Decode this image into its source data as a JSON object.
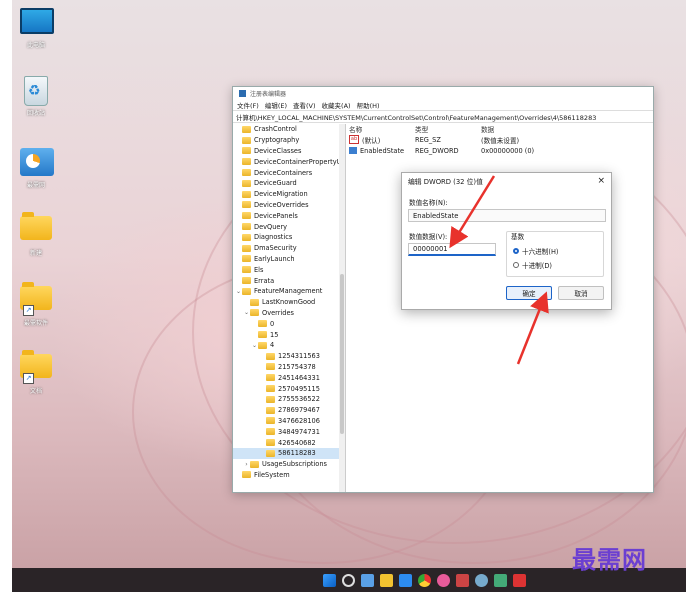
{
  "desktop": {
    "icons": [
      {
        "name": "此电脑"
      },
      {
        "name": "回收站"
      },
      {
        "name": "最需网"
      },
      {
        "name": "新建"
      },
      {
        "name": "最需软件"
      },
      {
        "name": "文档"
      }
    ]
  },
  "regedit": {
    "title": "注册表编辑器",
    "menu": [
      "文件(F)",
      "编辑(E)",
      "查看(V)",
      "收藏夹(A)",
      "帮助(H)"
    ],
    "address": "计算机\\HKEY_LOCAL_MACHINE\\SYSTEM\\CurrentControlSet\\Control\\FeatureManagement\\Overrides\\4\\586118283",
    "tree": [
      {
        "label": "CrashControl",
        "level": 0
      },
      {
        "label": "Cryptography",
        "level": 0
      },
      {
        "label": "DeviceClasses",
        "level": 0
      },
      {
        "label": "DeviceContainerPropertyUpda",
        "level": 0
      },
      {
        "label": "DeviceContainers",
        "level": 0
      },
      {
        "label": "DeviceGuard",
        "level": 0
      },
      {
        "label": "DeviceMigration",
        "level": 0
      },
      {
        "label": "DeviceOverrides",
        "level": 0
      },
      {
        "label": "DevicePanels",
        "level": 0
      },
      {
        "label": "DevQuery",
        "level": 0
      },
      {
        "label": "Diagnostics",
        "level": 0
      },
      {
        "label": "DmaSecurity",
        "level": 0
      },
      {
        "label": "EarlyLaunch",
        "level": 0
      },
      {
        "label": "Els",
        "level": 0
      },
      {
        "label": "Errata",
        "level": 0
      },
      {
        "label": "FeatureManagement",
        "level": 0
      },
      {
        "label": "LastKnownGood",
        "level": 1
      },
      {
        "label": "Overrides",
        "level": 1
      },
      {
        "label": "0",
        "level": 2
      },
      {
        "label": "15",
        "level": 2
      },
      {
        "label": "4",
        "level": 2
      },
      {
        "label": "1254311563",
        "level": 3
      },
      {
        "label": "215754378",
        "level": 3
      },
      {
        "label": "2451464331",
        "level": 3
      },
      {
        "label": "2570495115",
        "level": 3
      },
      {
        "label": "2755536522",
        "level": 3
      },
      {
        "label": "2786979467",
        "level": 3
      },
      {
        "label": "3476628106",
        "level": 3
      },
      {
        "label": "3484974731",
        "level": 3
      },
      {
        "label": "426540682",
        "level": 3
      },
      {
        "label": "586118283",
        "level": 3,
        "selected": true
      },
      {
        "label": "UsageSubscriptions",
        "level": 1
      },
      {
        "label": "FileSystem",
        "level": 0
      }
    ],
    "columns": {
      "name": "名称",
      "type": "类型",
      "data": "数据"
    },
    "values": [
      {
        "name": "(默认)",
        "type": "REG_SZ",
        "data": "(数值未设置)",
        "icon": "string-value-icon"
      },
      {
        "name": "EnabledState",
        "type": "REG_DWORD",
        "data": "0x00000000 (0)",
        "icon": "binary-value-icon"
      }
    ]
  },
  "dialog": {
    "title": "编辑 DWORD (32 位)值",
    "close": "×",
    "name_label": "数值名称(N):",
    "name_value": "EnabledState",
    "data_label": "数值数据(V):",
    "data_value": "00000001",
    "base_label": "基数",
    "radio_hex": "十六进制(H)",
    "radio_dec": "十进制(D)",
    "ok": "确定",
    "cancel": "取消"
  },
  "colors": {
    "arrow": "#e8322c",
    "accent": "#1d64c8"
  },
  "watermark": "最需网"
}
